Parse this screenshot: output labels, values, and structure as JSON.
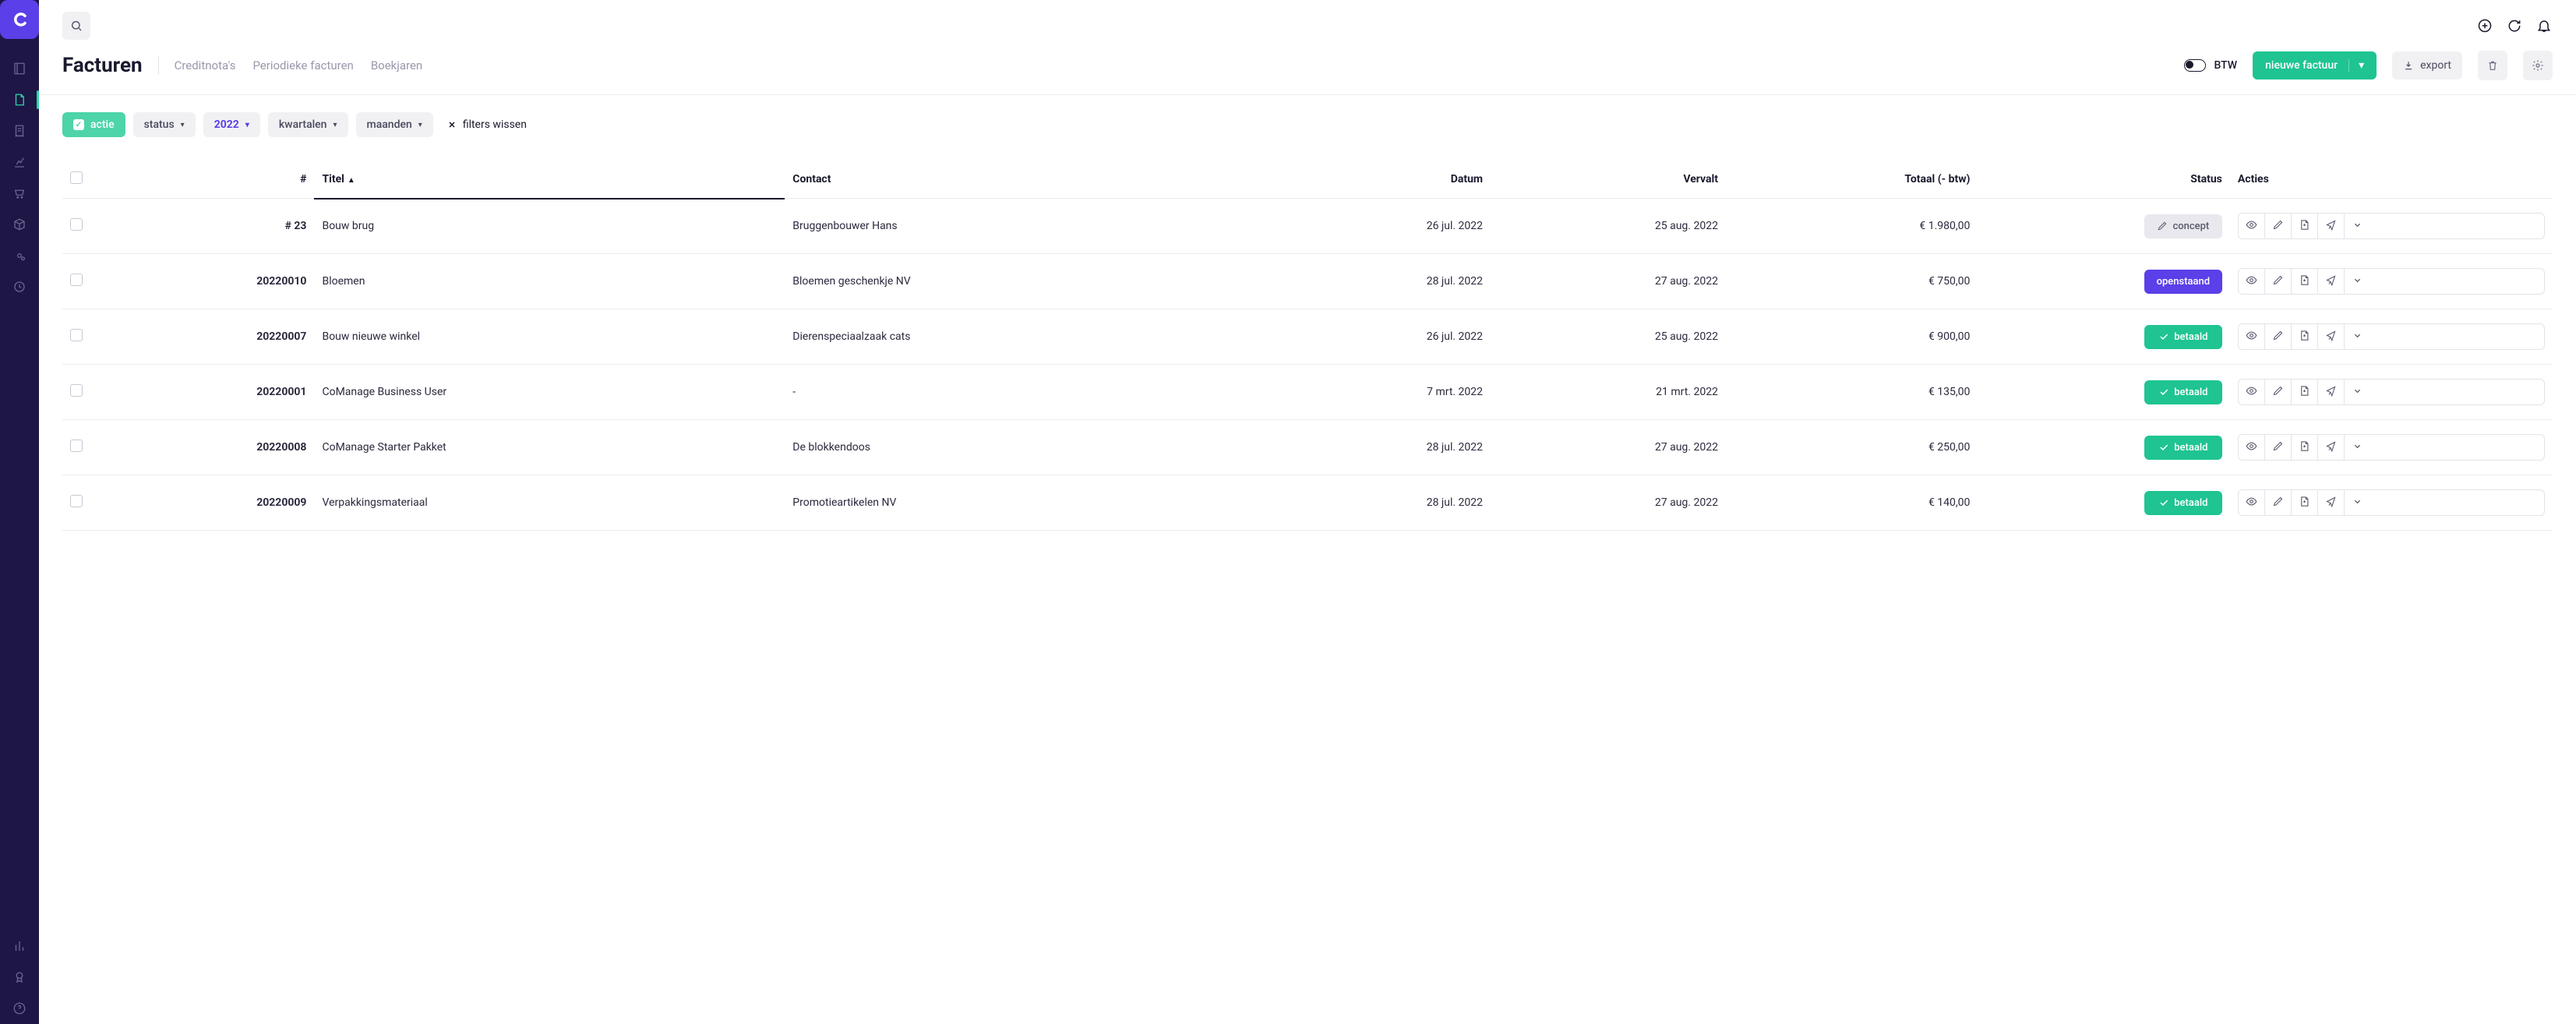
{
  "header": {
    "title": "Facturen",
    "tabs": [
      "Creditnota's",
      "Periodieke facturen",
      "Boekjaren"
    ],
    "btw_label": "BTW",
    "new_invoice_label": "nieuwe factuur",
    "export_label": "export"
  },
  "filters": {
    "action_label": "actie",
    "status_label": "status",
    "year_label": "2022",
    "quarters_label": "kwartalen",
    "months_label": "maanden",
    "clear_label": "filters wissen"
  },
  "columns": {
    "num": "#",
    "title": "Titel",
    "contact": "Contact",
    "date": "Datum",
    "due": "Vervalt",
    "total": "Totaal (- btw)",
    "status": "Status",
    "actions": "Acties"
  },
  "status_labels": {
    "concept": "concept",
    "openstaand": "openstaand",
    "betaald": "betaald"
  },
  "rows": [
    {
      "num": "# 23",
      "title": "Bouw brug",
      "contact": "Bruggenbouwer Hans",
      "date": "26 jul. 2022",
      "due": "25 aug. 2022",
      "total": "€ 1.980,00",
      "status": "concept"
    },
    {
      "num": "20220010",
      "title": "Bloemen",
      "contact": "Bloemen geschenkje NV",
      "date": "28 jul. 2022",
      "due": "27 aug. 2022",
      "total": "€ 750,00",
      "status": "openstaand"
    },
    {
      "num": "20220007",
      "title": "Bouw nieuwe winkel",
      "contact": "Dierenspeciaalzaak cats",
      "date": "26 jul. 2022",
      "due": "25 aug. 2022",
      "total": "€ 900,00",
      "status": "betaald"
    },
    {
      "num": "20220001",
      "title": "CoManage Business User",
      "contact": "-",
      "date": "7 mrt. 2022",
      "due": "21 mrt. 2022",
      "total": "€ 135,00",
      "status": "betaald"
    },
    {
      "num": "20220008",
      "title": "CoManage Starter Pakket",
      "contact": "De blokkendoos",
      "date": "28 jul. 2022",
      "due": "27 aug. 2022",
      "total": "€ 250,00",
      "status": "betaald"
    },
    {
      "num": "20220009",
      "title": "Verpakkingsmateriaal",
      "contact": "Promotieartikelen NV",
      "date": "28 jul. 2022",
      "due": "27 aug. 2022",
      "total": "€ 140,00",
      "status": "betaald"
    }
  ],
  "icons": {
    "sidebar": [
      "book",
      "file",
      "receipt",
      "chart",
      "cart",
      "package",
      "cog",
      "clock",
      "bar",
      "badge",
      "help"
    ]
  }
}
